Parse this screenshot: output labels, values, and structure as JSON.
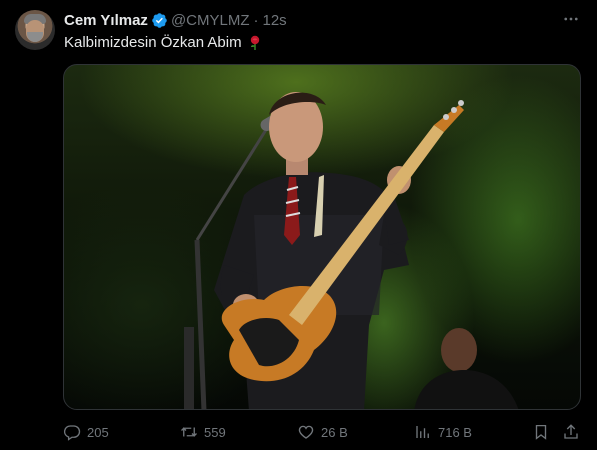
{
  "author": {
    "display_name": "Cem Yılmaz",
    "handle": "@CMYLMZ",
    "separator": "·",
    "timestamp": "12s",
    "verified": true,
    "avatar_icon": "avatar-photo"
  },
  "tweet": {
    "text": "Kalbimizdesin Özkan Abim",
    "emoji_icon": "rose-icon",
    "media_description_icon": "concert-photo"
  },
  "actions": {
    "replies": "205",
    "reposts": "559",
    "likes": "26 B",
    "views": "716 B"
  },
  "colors": {
    "background": "#000000",
    "text_primary": "#e7e9ea",
    "text_secondary": "#71767b",
    "verified_blue": "#1d9bf0",
    "border": "#2f3336"
  }
}
